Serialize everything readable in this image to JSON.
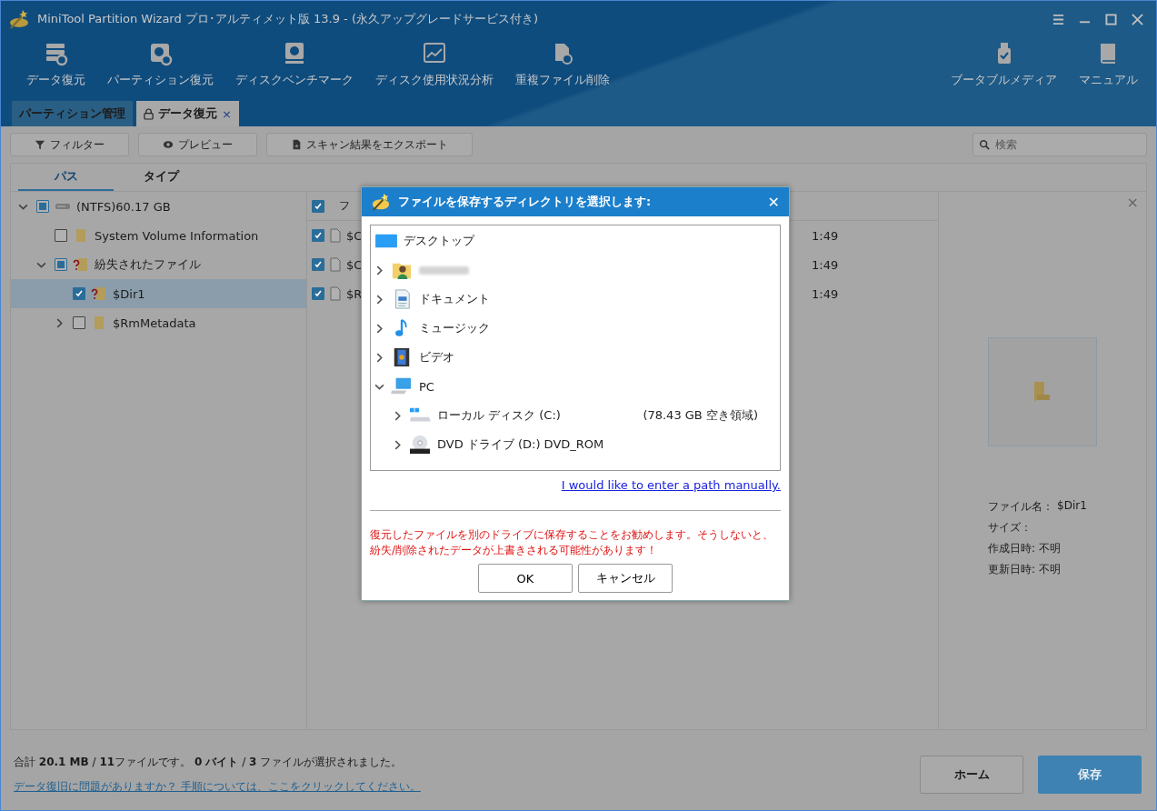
{
  "window": {
    "title": "MiniTool Partition Wizard プロ･アルティメット版 13.9 - (永久アップグレードサービス付き)"
  },
  "toolbar": {
    "left": [
      {
        "label": "データ復元"
      },
      {
        "label": "パーティション復元"
      },
      {
        "label": "ディスクベンチマーク"
      },
      {
        "label": "ディスク使用状況分析"
      },
      {
        "label": "重複ファイル削除"
      }
    ],
    "right": [
      {
        "label": "ブータブルメディア"
      },
      {
        "label": "マニュアル"
      }
    ]
  },
  "doc_tabs": [
    {
      "label": "パーティション管理",
      "selected": false,
      "locked": false,
      "closable": false
    },
    {
      "label": "データ復元",
      "selected": true,
      "locked": true,
      "closable": true,
      "close": "×"
    }
  ],
  "actions": [
    {
      "label": "フィルター"
    },
    {
      "label": "プレビュー"
    },
    {
      "label": "スキャン結果をエクスポート"
    }
  ],
  "search": {
    "placeholder": "検索"
  },
  "view_tabs": [
    {
      "label": "パス",
      "selected": true
    },
    {
      "label": "タイプ",
      "selected": false
    }
  ],
  "tree": {
    "items": [
      {
        "label": "(NTFS)60.17 GB",
        "kind": "drive",
        "expanded": true,
        "checked": false,
        "partial": true,
        "selected": false,
        "children": [
          {
            "label": "System Volume Information",
            "kind": "folder",
            "checked": false,
            "partial": false,
            "selected": false
          },
          {
            "label": "紛失されたファイル",
            "kind": "lost",
            "expanded": true,
            "checked": false,
            "partial": true,
            "selected": false,
            "children": [
              {
                "label": "$Dir1",
                "kind": "lost",
                "checked": true,
                "partial": false,
                "selected": true
              },
              {
                "label": "$RmMetadata",
                "kind": "folder",
                "expanded": false,
                "checked": false,
                "partial": false,
                "selected": false
              }
            ]
          }
        ]
      }
    ]
  },
  "file_list": {
    "header": {
      "checked": true,
      "column_1": "フ"
    },
    "rows": [
      {
        "checked": true,
        "name": "$C",
        "time": "1:49"
      },
      {
        "checked": true,
        "name": "$C",
        "time": "1:49"
      },
      {
        "checked": true,
        "name": "$R",
        "time": "1:49"
      }
    ]
  },
  "preview": {
    "close": "×",
    "fields": [
      {
        "label": "ファイル名：",
        "value": "$Dir1"
      },
      {
        "label": "サイズ："
      },
      {
        "label": "作成日時:",
        "value": "不明"
      },
      {
        "label": "更新日時:",
        "value": "不明"
      }
    ]
  },
  "status": {
    "summary": "合計 **20.1 MB** / **11**ファイルです。 **0 バイト** / **3** ファイルが選択されました。",
    "help_link": "データ復旧に問題がありますか？ 手順については、ここをクリックしてください。"
  },
  "bottom_buttons": [
    {
      "label": "ホーム",
      "kind": "secondary"
    },
    {
      "label": "保存",
      "kind": "primary"
    }
  ],
  "dialog": {
    "title": "ファイルを保存するディレクトリを選択します:",
    "close": "✕",
    "items": [
      {
        "label": "デスクトップ",
        "kind": "desktop"
      },
      {
        "kind": "user",
        "expanded": false,
        "blurred": true
      },
      {
        "label": "ドキュメント",
        "kind": "documents",
        "expanded": false
      },
      {
        "label": "ミュージック",
        "kind": "music",
        "expanded": false
      },
      {
        "label": "ビデオ",
        "kind": "video",
        "expanded": false
      },
      {
        "label": "PC",
        "kind": "pc",
        "expanded": true,
        "children": [
          {
            "label": "ローカル ディスク (C:)",
            "kind": "disk",
            "expanded": false,
            "free": "(78.43 GB 空き領域)"
          },
          {
            "label": "DVD ドライブ (D:) DVD_ROM",
            "kind": "dvd",
            "expanded": false
          }
        ]
      }
    ],
    "manual_link": "I would like to enter a path manually.",
    "warning": "復元したファイルを別のドライブに保存することをお勧めします。そうしないと、紛失/削除されたデータが上書きされる可能性があります！",
    "buttons": [
      {
        "label": "OK"
      },
      {
        "label": "キャンセル"
      }
    ]
  }
}
